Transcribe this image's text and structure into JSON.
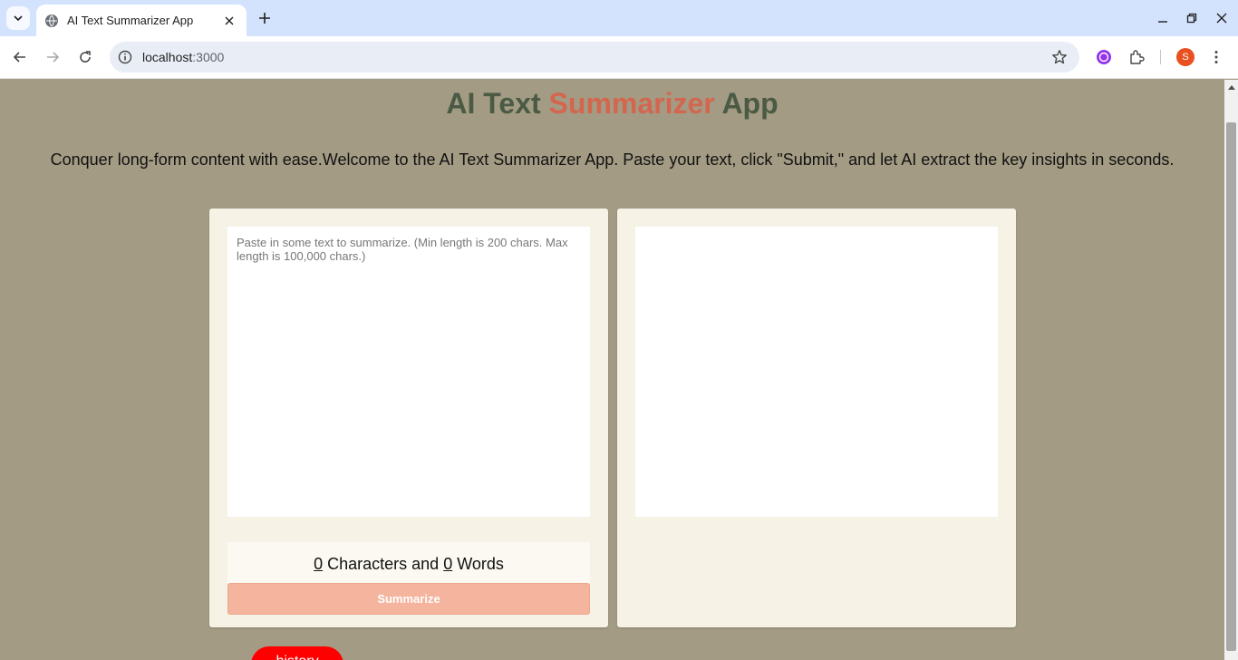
{
  "browser": {
    "tab_title": "AI Text Summarizer App",
    "url_host": "localhost",
    "url_port": ":3000",
    "profile_initial": "S"
  },
  "page": {
    "title_part1": "AI Text ",
    "title_accent": "Summarizer",
    "title_part2": " App",
    "intro": "Conquer long-form content with ease.Welcome to the AI Text Summarizer App. Paste your text, click \"Submit,\" and let AI extract the key insights in seconds.",
    "input_placeholder": "Paste in some text to summarize. (Min length is 200 chars. Max length is 100,000 chars.)",
    "char_count": "0",
    "chars_label": " Characters and ",
    "word_count": "0",
    "words_label": " Words",
    "summarize_label": "Summarize",
    "history_label": "history"
  },
  "colors": {
    "background": "#a39b83",
    "title": "#4b5a44",
    "accent": "#d4664f",
    "card": "#f6f2e6",
    "summarize_button": "#f4b49d",
    "history_button": "#ff0000"
  }
}
